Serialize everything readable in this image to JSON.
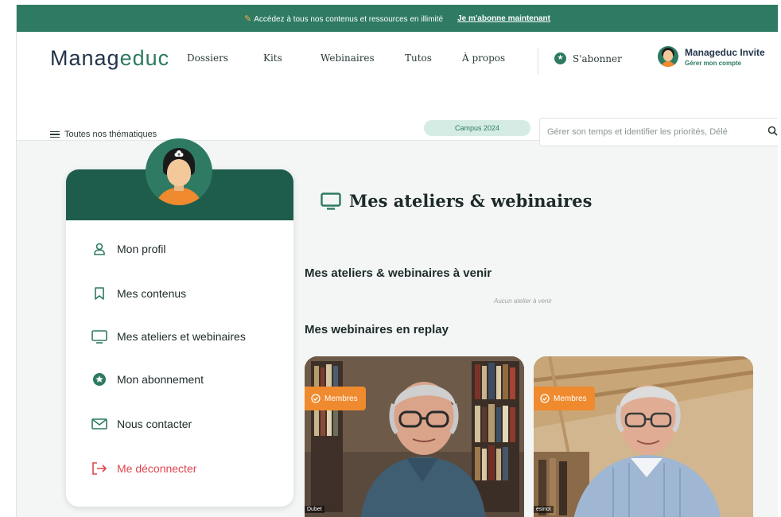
{
  "banner": {
    "text": "Accédez à tous nos contenus et ressources en illimité",
    "cta": "Je m'abonne maintenant"
  },
  "header": {
    "logo_a": "Manag",
    "logo_b": "educ",
    "nav": [
      "Dossiers",
      "Kits",
      "Webinaires",
      "Tutos",
      "À propos"
    ],
    "subscribe": "S'abonner",
    "user_name": "Manageduc Invite",
    "user_link": "Gérer mon compte",
    "themes": "Toutes nos thématiques",
    "campus": "Campus 2024",
    "search_placeholder": "Gérer son temps et identifier les priorités, Délé"
  },
  "sidebar": {
    "items": [
      {
        "label": "Mon profil",
        "icon": "user-icon"
      },
      {
        "label": "Mes contenus",
        "icon": "bookmark-icon"
      },
      {
        "label": "Mes ateliers et webinaires",
        "icon": "monitor-icon"
      },
      {
        "label": "Mon abonnement",
        "icon": "star-circle-icon"
      },
      {
        "label": "Nous contacter",
        "icon": "envelope-icon"
      },
      {
        "label": "Me déconnecter",
        "icon": "logout-icon"
      }
    ]
  },
  "main": {
    "title": "Mes ateliers & webinaires",
    "upcoming_heading": "Mes ateliers & webinaires à venir",
    "upcoming_empty": "Aucun atelier à venir",
    "replay_heading": "Mes webinaires en replay",
    "videos": [
      {
        "badge": "Membres",
        "nametag": "Dubet"
      },
      {
        "badge": "Membres",
        "nametag": "esinot"
      }
    ]
  },
  "colors": {
    "brand_green": "#2e7a63",
    "dark_green": "#1e5c4c",
    "accent_orange": "#ef8a2e",
    "logout_red": "#e0454f"
  }
}
